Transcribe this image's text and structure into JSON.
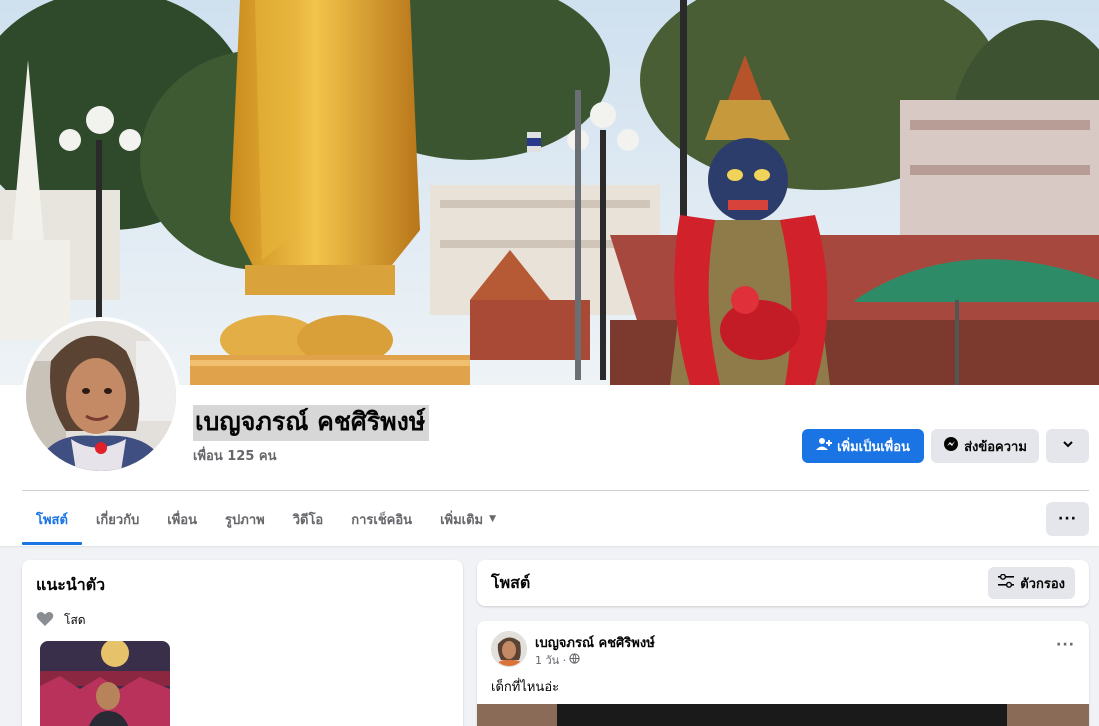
{
  "profile": {
    "name": "เบญจภรณ์ คชศิริพงษ์",
    "friends": "เพื่อน 125 คน"
  },
  "actions": {
    "add_friend": "เพิ่มเป็นเพื่อน",
    "message": "ส่งข้อความ"
  },
  "tabs": [
    {
      "label": "โพสต์"
    },
    {
      "label": "เกี่ยวกับ"
    },
    {
      "label": "เพื่อน"
    },
    {
      "label": "รูปภาพ"
    },
    {
      "label": "วิดีโอ"
    },
    {
      "label": "การเช็คอิน"
    },
    {
      "label": "เพิ่มเติม"
    }
  ],
  "intro": {
    "title": "แนะนำตัว",
    "relationship": "โสด"
  },
  "posts": {
    "title": "โพสต์",
    "filter_label": "ตัวกรอง"
  },
  "post": {
    "author": "เบญจภรณ์ คชศิริพงษ์",
    "time": "1 วัน ·",
    "text": "เด็กที่ไหนอ่ะ"
  },
  "colors": {
    "primary": "#1b74e4",
    "secondary_button": "#e4e6eb",
    "muted_text": "#65676b",
    "page_bg": "#f0f2f5"
  }
}
